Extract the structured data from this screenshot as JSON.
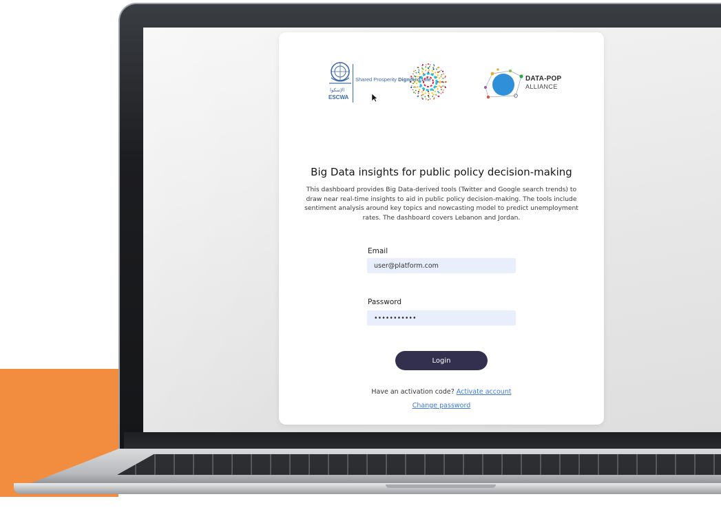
{
  "logos": {
    "un_arabic": "الإسكوا",
    "escwa": "ESCWA",
    "tagline_plain": "Shared Prosperity ",
    "tagline_bold": "Dignified Life",
    "dpa_title": "DATA-POP",
    "dpa_subtitle": "ALLIANCE"
  },
  "main": {
    "headline": "Big Data insights for public policy decision-making",
    "description": "This dashboard provides Big Data-derived tools (Twitter and Google search trends) to draw near real-time insights to aid in public policy decision-making. The tools include sentiment analysis around key topics and nowcasting model to predict unemployment rates. The dashboard covers Lebanon and Jordan."
  },
  "form": {
    "email_label": "Email",
    "email_value": "user@platform.com",
    "password_label": "Password",
    "password_value": "•••••••••••",
    "login_label": "Login"
  },
  "footer": {
    "activation_prompt": "Have an activation code? ",
    "activate_link": "Activate account",
    "change_password_link": "Change password"
  },
  "colors": {
    "accent_orange": "#f28c3e",
    "button_navy": "#322f4f",
    "link_blue": "#3d78d8",
    "input_bg": "#e8eefb"
  }
}
